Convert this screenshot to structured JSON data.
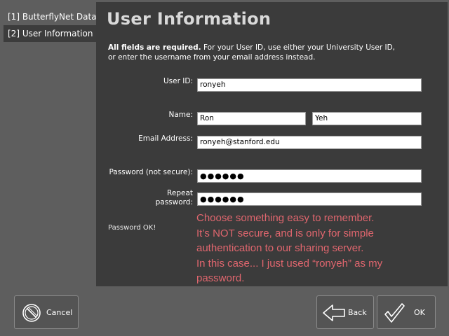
{
  "sidebar": {
    "items": [
      {
        "label": "[1] ButterflyNet Data"
      },
      {
        "label": "[2] User Information"
      }
    ]
  },
  "main": {
    "title": "User Information",
    "instructions_bold": "All fields are required.",
    "instructions_text": " For your User ID, use either your University User ID, or enter the username from your email address instead.",
    "labels": {
      "user_id": "User ID:",
      "name": "Name:",
      "email": "Email Address:",
      "password": "Password (not secure):",
      "repeat_line1": "Repeat",
      "repeat_line2": "password:"
    },
    "fields": {
      "user_id": "ronyeh",
      "first_name": "Ron",
      "last_name": "Yeh",
      "email": "ronyeh@stanford.edu",
      "password": "●●●●●●",
      "repeat_password": "●●●●●●"
    },
    "status": "Password OK!",
    "annotation": [
      "Choose something easy to remember.",
      "It’s NOT secure, and is only for simple",
      "authentication to our sharing server.",
      "In this case...  I just used “ronyeh” as my",
      "password."
    ]
  },
  "buttons": {
    "cancel": "Cancel",
    "back": "Back",
    "ok": "OK"
  },
  "colors": {
    "panel": "#3b3b3b",
    "annotation": "#e0666e",
    "title": "#d9d9d9"
  },
  "icons": {
    "cancel": "cancel-circle-icon",
    "back": "back-arrow-icon",
    "ok": "checkmark-icon"
  }
}
